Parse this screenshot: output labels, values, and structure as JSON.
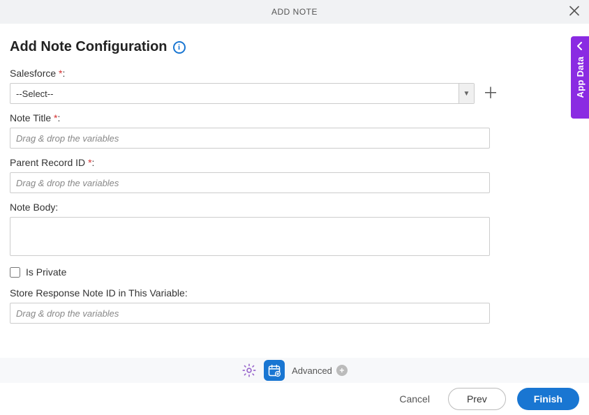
{
  "header": {
    "title": "ADD NOTE"
  },
  "pageTitle": "Add Note Configuration",
  "sideTab": {
    "label": "App Data"
  },
  "fields": {
    "salesforce": {
      "label": "Salesforce",
      "required": "*",
      "selected": "--Select--"
    },
    "noteTitle": {
      "label": "Note Title",
      "required": "*",
      "placeholder": "Drag & drop the variables",
      "value": ""
    },
    "parentRecordId": {
      "label": "Parent Record ID",
      "required": "*",
      "placeholder": "Drag & drop the variables",
      "value": ""
    },
    "noteBody": {
      "label": "Note Body:",
      "value": ""
    },
    "isPrivate": {
      "label": "Is Private",
      "checked": false
    },
    "storeResponse": {
      "label": "Store Response Note ID in This Variable:",
      "placeholder": "Drag & drop the variables",
      "value": ""
    }
  },
  "toolbar": {
    "advanced": "Advanced"
  },
  "footer": {
    "cancel": "Cancel",
    "prev": "Prev",
    "finish": "Finish"
  }
}
